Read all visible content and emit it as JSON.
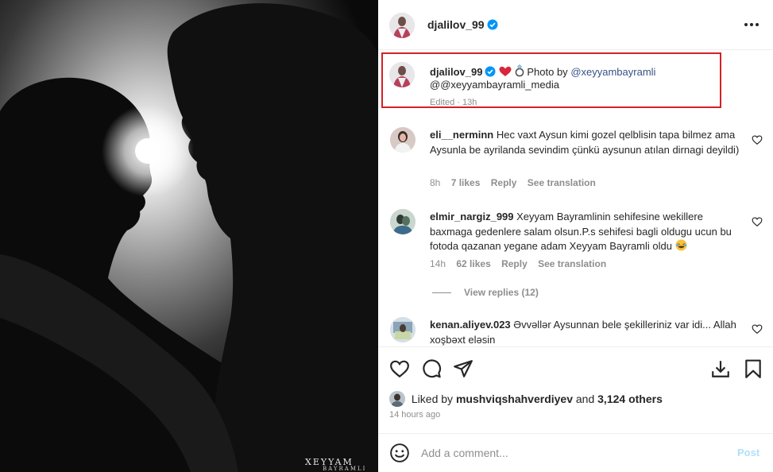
{
  "photo": {
    "watermark_main": "XEYYAM",
    "watermark_sub": "BAYRAMLI"
  },
  "header": {
    "username": "djalilov_99",
    "more_icon": "more-horizontal-icon"
  },
  "caption": {
    "username": "djalilov_99",
    "photo_by_prefix": "Photo by",
    "photo_by_handle": "@xeyyambayramli",
    "line2": "@@xeyyambayramli_media",
    "edited": "Edited · 13h",
    "highlight_color": "#d42026"
  },
  "comments": [
    {
      "username": "eli__nerminn",
      "text": "Hec vaxt Aysun kimi gozel qelblisin tapa bilmez ama Aysunla be ayrilanda sevindim çünkü aysunun atılan dirnagi deyildi)",
      "time": "8h",
      "likes": "7 likes",
      "reply": "Reply",
      "translate": "See translation"
    },
    {
      "username": "elmir_nargiz_999",
      "text": "Xeyyam Bayramlinin sehifesine wekillere baxmaga gedenlere salam olsun.P.s sehifesi bagli oldugu ucun bu fotoda qazanan yegane adam Xeyyam Bayramli oldu",
      "time": "14h",
      "likes": "62 likes",
      "reply": "Reply",
      "translate": "See translation",
      "view_replies": "View replies (12)"
    },
    {
      "username": "kenan.aliyev.023",
      "text": "Əvvəllər Aysunnan bele şekilleriniz var idi... Allah xoşbəxt eləsin"
    }
  ],
  "actions": {
    "liked_by_prefix": "Liked by",
    "liked_by_user": "mushviqshahverdiyev",
    "and": "and",
    "others": "3,124 others",
    "time_ago": "14 hours ago"
  },
  "add_comment": {
    "placeholder": "Add a comment...",
    "post_label": "Post"
  },
  "colors": {
    "link": "#385185",
    "verified": "#0095f6",
    "muted": "#8e8e8e",
    "post_button": "#b2dffc"
  }
}
